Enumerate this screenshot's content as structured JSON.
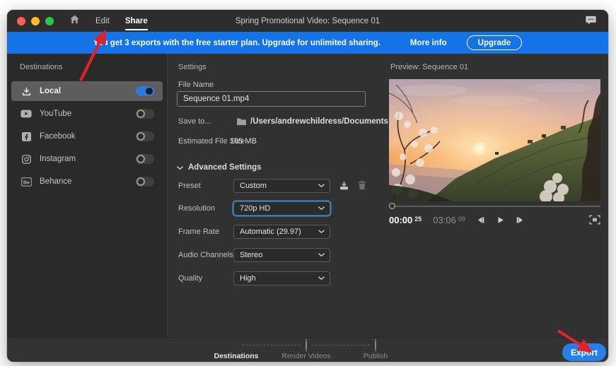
{
  "window": {
    "title": "Spring Promotional Video: Sequence 01",
    "menu_edit": "Edit",
    "menu_share": "Share"
  },
  "banner": {
    "message": "You get 3 exports with the free starter plan. Upgrade for unlimited sharing.",
    "more_info": "More info",
    "upgrade": "Upgrade"
  },
  "sidebar": {
    "heading": "Destinations",
    "items": [
      {
        "label": "Local",
        "icon": "download-icon",
        "enabled": true,
        "selected": true
      },
      {
        "label": "YouTube",
        "icon": "youtube-icon",
        "enabled": false,
        "selected": false
      },
      {
        "label": "Facebook",
        "icon": "facebook-icon",
        "enabled": false,
        "selected": false
      },
      {
        "label": "Instagram",
        "icon": "instagram-icon",
        "enabled": false,
        "selected": false
      },
      {
        "label": "Behance",
        "icon": "behance-icon",
        "enabled": false,
        "selected": false
      }
    ]
  },
  "settings": {
    "heading": "Settings",
    "file_name_label": "File Name",
    "file_name_value": "Sequence 01.mp4",
    "save_to_label": "Save to...",
    "save_to_value": "/Users/andrewchildress/Documents",
    "estimated_label": "Estimated File Size",
    "estimated_value": "195 MB",
    "advanced_label": "Advanced Settings",
    "fields": [
      {
        "label": "Preset",
        "value": "Custom"
      },
      {
        "label": "Resolution",
        "value": "720p HD",
        "focused": true
      },
      {
        "label": "Frame Rate",
        "value": "Automatic (29.97)"
      },
      {
        "label": "Audio Channels",
        "value": "Stereo"
      },
      {
        "label": "Quality",
        "value": "High"
      }
    ]
  },
  "preview": {
    "heading": "Preview: Sequence 01",
    "scene": "sunset over blossoming hillside",
    "current_time": "00:00",
    "current_frames": "25",
    "duration_time": "03:06",
    "duration_frames": "09"
  },
  "footer": {
    "steps": [
      {
        "label": "Destinations",
        "active": true
      },
      {
        "label": "Render Videos",
        "active": false
      },
      {
        "label": "Publish",
        "active": false
      }
    ],
    "export_label": "Export"
  },
  "colors": {
    "banner_blue": "#1473e6",
    "export_blue": "#2680eb",
    "toggle_on_blue": "#2a7ae0",
    "focus_ring_blue": "#2f8ee8",
    "annotation_red": "#e0222a"
  }
}
